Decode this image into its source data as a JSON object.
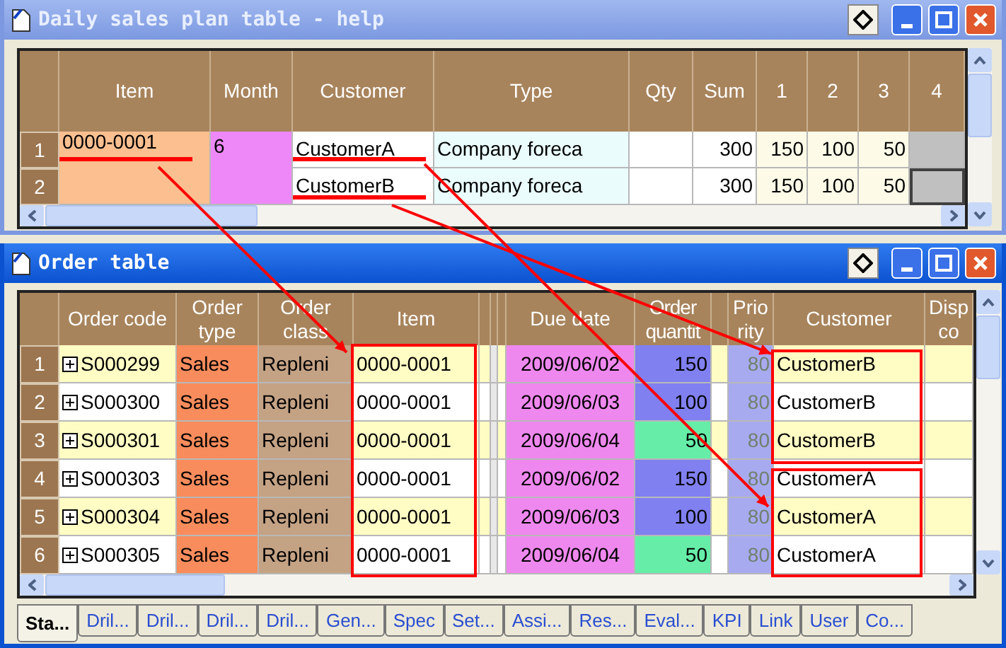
{
  "plan_window": {
    "title": "Daily sales plan table - help",
    "active": false,
    "columns": [
      "Item",
      "Month",
      "Customer",
      "Type",
      "Qty",
      "Sum",
      "1",
      "2",
      "3",
      "4"
    ],
    "item": "0000-0001",
    "month": "6",
    "rows": [
      {
        "row": "1",
        "customer": "CustomerA",
        "type": "Company foreca",
        "sum": "300",
        "d1": "150",
        "d2": "100",
        "d3": "50",
        "selected": false
      },
      {
        "row": "2",
        "customer": "CustomerB",
        "type": "Company foreca",
        "sum": "300",
        "d1": "150",
        "d2": "100",
        "d3": "50",
        "selected": true
      }
    ]
  },
  "order_window": {
    "title": "Order table",
    "active": true,
    "columns": [
      "Order code",
      "Order type",
      "Order class",
      "Item",
      "Due date",
      "Order quantit",
      "Prio rity",
      "Customer",
      "Disp co"
    ],
    "rows": [
      {
        "row": "1",
        "code": "S000299",
        "type": "Sales",
        "class": "Repleni",
        "item": "0000-0001",
        "due": "2009/06/02",
        "quantity": {
          "text": "150",
          "color": "#8080f0"
        },
        "priority": "80",
        "customer": "CustomerB"
      },
      {
        "row": "2",
        "code": "S000300",
        "type": "Sales",
        "class": "Repleni",
        "item": "0000-0001",
        "due": "2009/06/03",
        "quantity": {
          "text": "100",
          "color": "#8080f0"
        },
        "priority": "80",
        "customer": "CustomerB"
      },
      {
        "row": "3",
        "code": "S000301",
        "type": "Sales",
        "class": "Repleni",
        "item": "0000-0001",
        "due": "2009/06/04",
        "quantity": {
          "text": "50",
          "color": "#66eea8"
        },
        "priority": "80",
        "customer": "CustomerB"
      },
      {
        "row": "4",
        "code": "S000303",
        "type": "Sales",
        "class": "Repleni",
        "item": "0000-0001",
        "due": "2009/06/02",
        "quantity": {
          "text": "150",
          "color": "#8080f0"
        },
        "priority": "80",
        "customer": "CustomerA"
      },
      {
        "row": "5",
        "code": "S000304",
        "type": "Sales",
        "class": "Repleni",
        "item": "0000-0001",
        "due": "2009/06/03",
        "quantity": {
          "text": "100",
          "color": "#8080f0"
        },
        "priority": "80",
        "customer": "CustomerA"
      },
      {
        "row": "6",
        "code": "S000305",
        "type": "Sales",
        "class": "Repleni",
        "item": "0000-0001",
        "due": "2009/06/04",
        "quantity": {
          "text": "50",
          "color": "#66eea8"
        },
        "priority": "80",
        "customer": "CustomerA"
      }
    ]
  },
  "tabs": [
    {
      "label": "Sta...",
      "selected": true
    },
    {
      "label": "Dril...",
      "selected": false
    },
    {
      "label": "Dril...",
      "selected": false
    },
    {
      "label": "Dril...",
      "selected": false
    },
    {
      "label": "Dril...",
      "selected": false
    },
    {
      "label": "Gen...",
      "selected": false
    },
    {
      "label": "Spec",
      "selected": false
    },
    {
      "label": "Set...",
      "selected": false
    },
    {
      "label": "Assi...",
      "selected": false
    },
    {
      "label": "Res...",
      "selected": false
    },
    {
      "label": "Eval...",
      "selected": false
    },
    {
      "label": "KPI",
      "selected": false
    },
    {
      "label": "Link",
      "selected": false
    },
    {
      "label": "User",
      "selected": false
    },
    {
      "label": "Co...",
      "selected": false
    }
  ]
}
